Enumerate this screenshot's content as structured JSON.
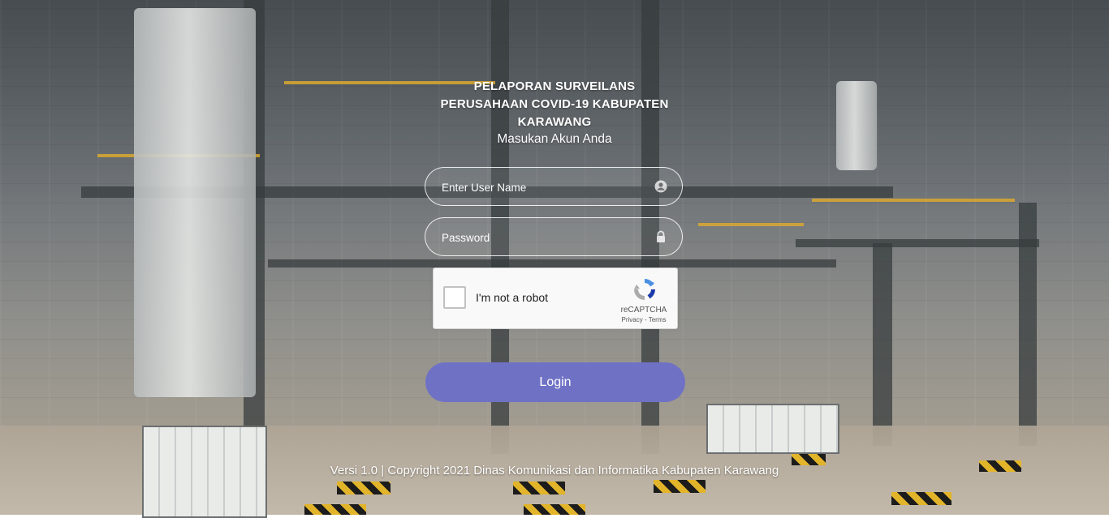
{
  "header": {
    "title_line1": "PELAPORAN SURVEILANS",
    "title_line2": "PERUSAHAAN COVID-19 KABUPATEN",
    "title_line3": "KARAWANG",
    "subtitle": "Masukan Akun Anda"
  },
  "form": {
    "username_placeholder": "Enter User Name",
    "username_icon": "user-circle-icon",
    "password_placeholder": "Password",
    "password_icon": "lock-icon",
    "login_label": "Login"
  },
  "recaptcha": {
    "checkbox_label": "I'm not a robot",
    "brand": "reCAPTCHA",
    "privacy": "Privacy",
    "separator": " - ",
    "terms": "Terms",
    "icon": "recaptcha-logo-icon"
  },
  "footer": {
    "text": "Versi 1.0 | Copyright 2021 Dinas Komunikasi dan Informatika Kabupaten Karawang"
  },
  "colors": {
    "login_button": "#6f72c4",
    "text": "#ffffff"
  }
}
